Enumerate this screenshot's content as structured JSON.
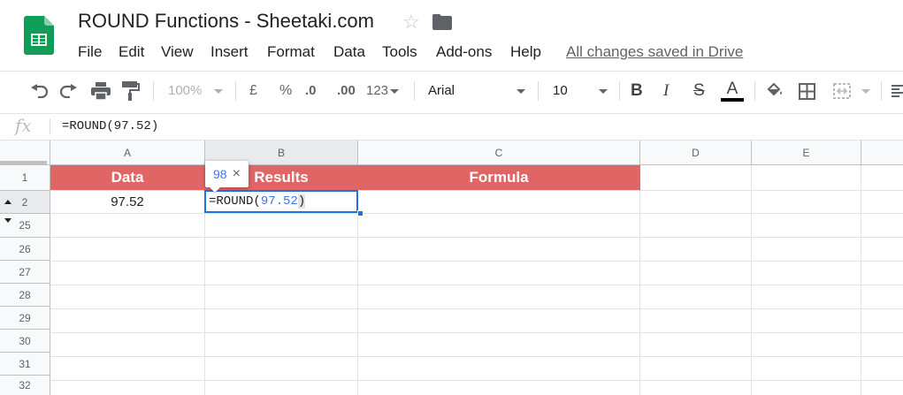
{
  "header": {
    "title": "ROUND Functions - Sheetaki.com",
    "menu": [
      "File",
      "Edit",
      "View",
      "Insert",
      "Format",
      "Data",
      "Tools",
      "Add-ons",
      "Help"
    ],
    "save_status": "All changes saved in Drive",
    "icons": [
      "sheets-logo",
      "star-icon",
      "folder-icon"
    ]
  },
  "toolbar": {
    "zoom": "100%",
    "currency": "£",
    "percent": "%",
    "decrease_decimal": ".0",
    "increase_decimal": ".00",
    "more_formats": "123",
    "font": "Arial",
    "font_size": "10",
    "bold": "B",
    "italic": "I",
    "strikethrough": "S",
    "text_color": "A",
    "text_color_value": "#000000"
  },
  "formula_bar": {
    "fx": "fx",
    "content": "=ROUND(97.52)"
  },
  "grid": {
    "columns": [
      "A",
      "B",
      "C",
      "D",
      "E"
    ],
    "rows": [
      "1",
      "2",
      "25",
      "26",
      "27",
      "28",
      "29",
      "30",
      "31",
      "32"
    ],
    "header_fill": "#e06666",
    "cells": {
      "A1": "Data",
      "B1": "Results",
      "C1": "Formula",
      "A2": "97.52",
      "B2_prefix": "=ROUND(",
      "B2_arg": "97.52",
      "B2_suffix": ")"
    },
    "tooltip": {
      "value": "98",
      "close": "×"
    }
  }
}
